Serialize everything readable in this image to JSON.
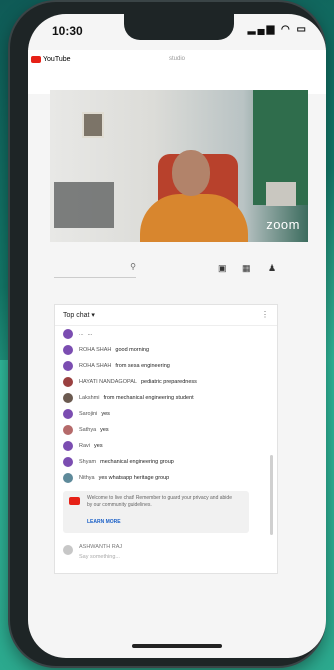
{
  "status": {
    "time": "10:30",
    "icons": "signal wifi battery"
  },
  "app": {
    "logo_text": "YouTube",
    "url": "studio"
  },
  "video": {
    "watermark": "zoom"
  },
  "controls": {
    "search_icon": "search-icon",
    "video_icon": "camera-icon",
    "grid_icon": "grid-icon",
    "bell_icon": "bell-icon"
  },
  "chat": {
    "title": "Top chat ▾",
    "messages": [
      {
        "name": "...",
        "text": "..."
      },
      {
        "name": "ROHA SHAH",
        "text": "good morning"
      },
      {
        "name": "ROHA SHAH",
        "text": "from sesa engineering"
      },
      {
        "name": "HAYATI NANDAGOPAL",
        "text": "pediatric preparedness"
      },
      {
        "name": "Lakshmi",
        "text": "from mechanical engineering student"
      },
      {
        "name": "Sarojini",
        "text": "yes"
      },
      {
        "name": "Sathya",
        "text": "yes"
      },
      {
        "name": "Ravi",
        "text": "yes"
      },
      {
        "name": "Shyam",
        "text": "mechanical engineering group"
      },
      {
        "name": "Nithya",
        "text": "yes whatsapp heritage group"
      }
    ],
    "notice_text": "Welcome to live chat! Remember to guard your privacy and abide by our community guidelines.",
    "notice_link": "LEARN MORE",
    "input_name": "ASHWANTH RAJ",
    "input_placeholder": "Say something..."
  }
}
